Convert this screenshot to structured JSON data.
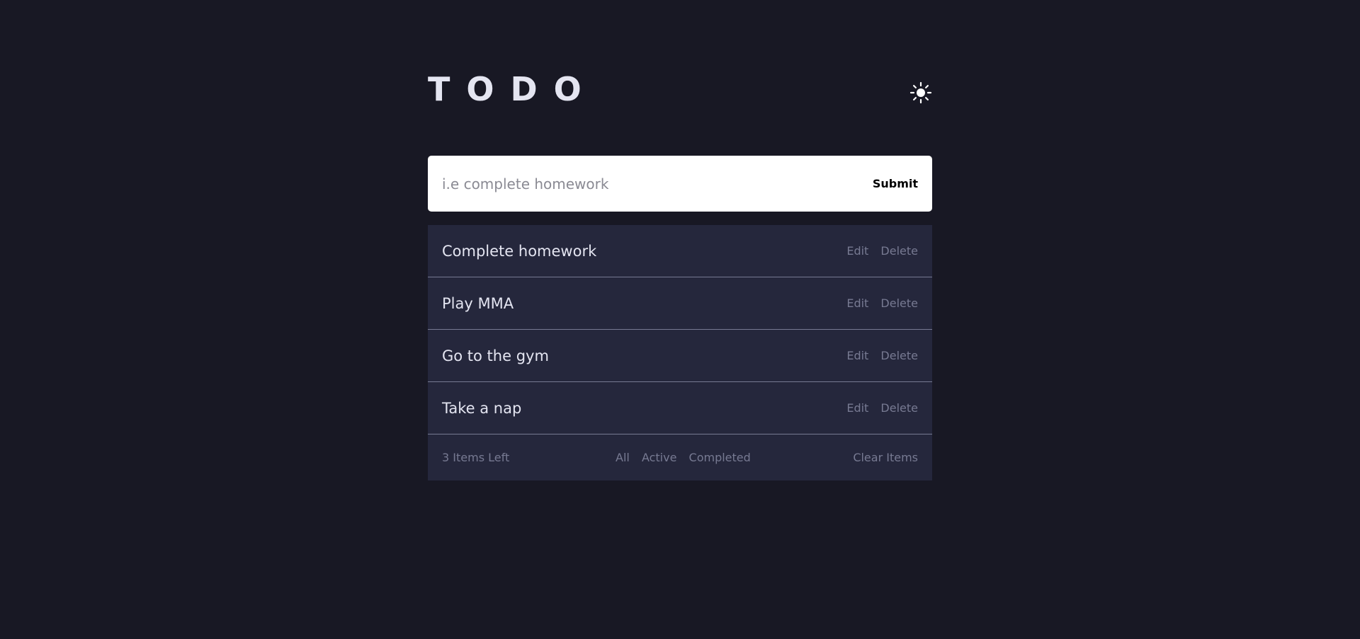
{
  "header": {
    "title": "TODO",
    "theme_toggle_icon": "sun-icon"
  },
  "add_form": {
    "placeholder": "i.e complete homework",
    "value": "",
    "submit_label": "Submit"
  },
  "todos": [
    {
      "text": "Complete homework",
      "edit_label": "Edit",
      "delete_label": "Delete"
    },
    {
      "text": "Play MMA",
      "edit_label": "Edit",
      "delete_label": "Delete"
    },
    {
      "text": "Go to the gym",
      "edit_label": "Edit",
      "delete_label": "Delete"
    },
    {
      "text": "Take a nap",
      "edit_label": "Edit",
      "delete_label": "Delete"
    }
  ],
  "footer": {
    "items_left": "3 Items Left",
    "filters": [
      "All",
      "Active",
      "Completed"
    ],
    "clear_label": "Clear Items"
  },
  "colors": {
    "background": "#181824",
    "panel": "#25273c",
    "text_primary": "#e4e5f1",
    "text_muted": "#777a92",
    "input_bg": "#ffffff"
  }
}
